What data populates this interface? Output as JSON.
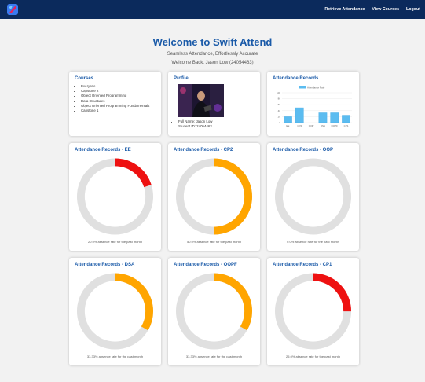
{
  "nav": {
    "links": [
      "Retrieve Attendance",
      "View Courses",
      "Logout"
    ]
  },
  "hero": {
    "title": "Welcome to Swift Attend",
    "subtitle": "Seamless Attendance, Effortlessly Accurate",
    "welcome": "Welcome Back, Jason Low (24054463)"
  },
  "courses": {
    "title": "Courses",
    "items": [
      "Everyone",
      "Capstone 2",
      "Object Oriented Programming",
      "Data Structures",
      "Object Oriented Programming Fundamentals",
      "Capstone 1"
    ]
  },
  "profile": {
    "title": "Profile",
    "full_name": "Full Name: Jason Low",
    "student_id": "Student ID: 24054463"
  },
  "attendance_chart": {
    "title": "Attendance Records"
  },
  "chart_data": [
    {
      "type": "bar",
      "legend": "Attendance Rate",
      "categories": [
        "EE",
        "CP2",
        "OOP",
        "DSA",
        "OOPF",
        "CP1"
      ],
      "values": [
        20,
        50,
        0,
        33,
        33,
        25
      ],
      "ylim": [
        0,
        100
      ],
      "yticks": [
        0,
        20,
        40,
        60,
        80,
        100
      ],
      "color": "#5bbcf0",
      "grid": true,
      "legend_position": "top"
    }
  ],
  "donuts": [
    {
      "title": "Attendance Records - EE",
      "absence": 0.2,
      "color": "#ee1111",
      "caption": "20.0% absence rate for the past month"
    },
    {
      "title": "Attendance Records - CP2",
      "absence": 0.5,
      "color": "#ffa500",
      "caption": "50.0% absence rate for the past month"
    },
    {
      "title": "Attendance Records - OOP",
      "absence": 0.0,
      "color": "#ffa500",
      "caption": "0.0% absence rate for the past month"
    },
    {
      "title": "Attendance Records - DSA",
      "absence": 0.3333,
      "color": "#ffa500",
      "caption": "33.33% absence rate for the past month"
    },
    {
      "title": "Attendance Records - OOPF",
      "absence": 0.3333,
      "color": "#ffa500",
      "caption": "33.33% absence rate for the past month"
    },
    {
      "title": "Attendance Records - CP1",
      "absence": 0.25,
      "color": "#ee1111",
      "caption": "25.0% absence rate for the past month"
    }
  ],
  "colors": {
    "navbar": "#0b2a5c",
    "accent": "#1a5aa8",
    "ring_track": "#e0e0e0"
  }
}
